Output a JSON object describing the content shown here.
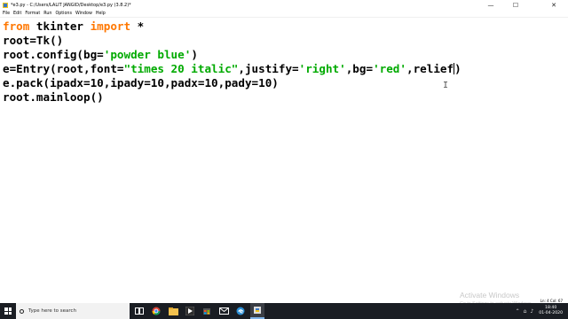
{
  "window": {
    "title": "*e3.py - C:/Users/LALIT JANGID/Desktop/e3.py (3.8.2)*",
    "controls": {
      "minimize": "—",
      "maximize": "☐",
      "close": "✕"
    }
  },
  "menu": [
    "File",
    "Edit",
    "Format",
    "Run",
    "Options",
    "Window",
    "Help"
  ],
  "code": {
    "line1": {
      "kw1": "from",
      "mid": " tkinter ",
      "kw2": "import",
      "rest": " *"
    },
    "line2": "root=Tk()",
    "line3": {
      "pre": "root.config(bg=",
      "str": "'powder blue'",
      "post": ")"
    },
    "line4": {
      "p1": "e=Entry(root,font=",
      "s1": "\"times 20 italic\"",
      "p2": ",justify=",
      "s2": "'right'",
      "p3": ",bg=",
      "s3": "'red'",
      "p4": ",relief",
      "p5": ")"
    },
    "line5": "e.pack(ipadx=10,ipady=10,padx=10,pady=10)",
    "line6": "root.mainloop()"
  },
  "watermark": {
    "title": "Activate Windows",
    "subtitle": "Go to Settings to activate Windows."
  },
  "status": "Ln: 4   Col: 67",
  "taskbar": {
    "search_placeholder": "Type here to search",
    "time": "18:40",
    "date": "01-04-2020"
  },
  "icons": {
    "app": "python-idle-icon",
    "search": "search-icon",
    "taskview": "task-view-icon",
    "chrome": "chrome-icon",
    "folder": "file-explorer-icon"
  },
  "colors": {
    "keyword": "#ff7700",
    "string": "#00aa00",
    "taskbar": "#1a1d23"
  }
}
